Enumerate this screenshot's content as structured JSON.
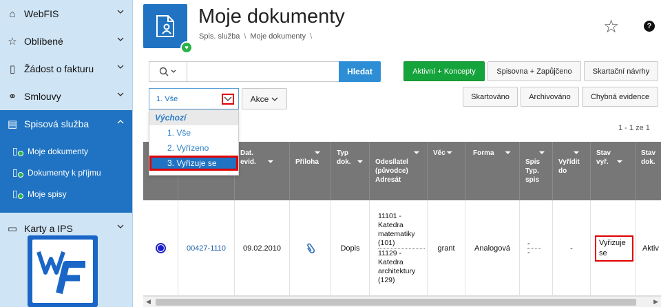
{
  "sidebar": {
    "items": [
      {
        "label": "WebFIS",
        "icon": "home-icon"
      },
      {
        "label": "Oblíbené",
        "icon": "star-icon"
      },
      {
        "label": "Žádost o fakturu",
        "icon": "invoice-icon"
      },
      {
        "label": "Smlouvy",
        "icon": "handshake-icon"
      },
      {
        "label": "Spisová služba",
        "icon": "document-icon"
      },
      {
        "label": "Karty a IPS",
        "icon": "card-icon"
      }
    ],
    "submenu": [
      {
        "label": "Moje dokumenty"
      },
      {
        "label": "Dokumenty k příjmu"
      },
      {
        "label": "Moje spisy"
      }
    ]
  },
  "header": {
    "title": "Moje dokumenty",
    "breadcrumb": [
      "Spis. služba",
      "Moje dokumenty"
    ]
  },
  "search": {
    "placeholder": "",
    "submit_label": "Hledat"
  },
  "filters": {
    "row1": [
      "Aktivní + Koncepty",
      "Spisovna + Zapůjčeno",
      "Skartační návrhy"
    ],
    "row2": [
      "Skartováno",
      "Archivováno",
      "Chybná evidence"
    ]
  },
  "select": {
    "value": "1. Vše",
    "group_label": "Výchozí",
    "options": [
      "1. Vše",
      "2. Vyřízeno",
      "3. Vyřizuje se"
    ]
  },
  "akce_label": "Akce",
  "pagination": {
    "text": "1 - 1 ze 1"
  },
  "table": {
    "columns": [
      "Dat. evid.",
      "Příloha",
      "Typ dok.",
      "Odesílatel (původce) Adresát",
      "Věc",
      "Forma",
      "Spis Typ. spis",
      "Vyřídit do",
      "Stav vyř.",
      "Stav dok."
    ],
    "row": {
      "id": "00427-1110",
      "date": "09.02.2010",
      "type": "Dopis",
      "sender1": "11101 - Katedra matematiky (101)",
      "sender2": "11129 - Katedra architektury (129)",
      "vec": "grant",
      "forma": "Analogová",
      "spis": "-",
      "spis2": "-",
      "vyridit": "-",
      "stav_vyr": "Vyřizuje se",
      "stav_dok": "Aktiv"
    }
  },
  "colors": {
    "sidebar_bg": "#cfe4f5",
    "accent": "#1f73c2",
    "green": "#15a33b",
    "highlight": "#e00000"
  }
}
